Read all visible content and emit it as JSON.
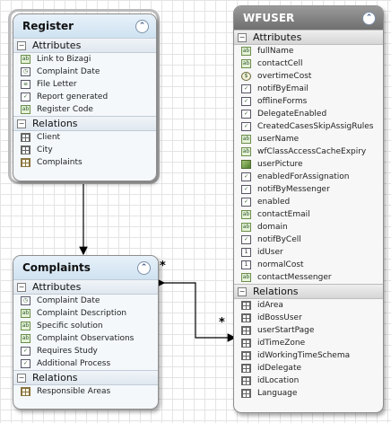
{
  "register": {
    "title": "Register",
    "collapse_glyph": "⌃",
    "attributes_label": "Attributes",
    "attributes": [
      {
        "label": "Link to Bizagi",
        "icon": "abc"
      },
      {
        "label": "Complaint Date",
        "icon": "date"
      },
      {
        "label": "File Letter",
        "icon": "file"
      },
      {
        "label": "Report generated",
        "icon": "bool"
      },
      {
        "label": "Register Code",
        "icon": "abc"
      }
    ],
    "relations_label": "Relations",
    "relations": [
      {
        "label": "Client",
        "icon": "rel"
      },
      {
        "label": "City",
        "icon": "rel"
      },
      {
        "label": "Complaints",
        "icon": "rel-multi"
      }
    ]
  },
  "complaints": {
    "title": "Complaints",
    "collapse_glyph": "⌃",
    "attributes_label": "Attributes",
    "attributes": [
      {
        "label": "Complaint Date",
        "icon": "date"
      },
      {
        "label": "Complaint Description",
        "icon": "abc"
      },
      {
        "label": "Specific solution",
        "icon": "abc"
      },
      {
        "label": "Complaint Observations",
        "icon": "abc"
      },
      {
        "label": "Requires Study",
        "icon": "bool"
      },
      {
        "label": "Additional Process",
        "icon": "bool"
      }
    ],
    "relations_label": "Relations",
    "relations": [
      {
        "label": "Responsible Areas",
        "icon": "rel-multi"
      }
    ]
  },
  "wfuser": {
    "title": "WFUSER",
    "collapse_glyph": "⌃",
    "attributes_label": "Attributes",
    "attributes": [
      {
        "label": "fullName",
        "icon": "abc"
      },
      {
        "label": "contactCell",
        "icon": "abc"
      },
      {
        "label": "overtimeCost",
        "icon": "cur"
      },
      {
        "label": "notifByEmail",
        "icon": "bool"
      },
      {
        "label": "offlineForms",
        "icon": "bool"
      },
      {
        "label": "DelegateEnabled",
        "icon": "bool"
      },
      {
        "label": "CreatedCasesSkipAssigRules",
        "icon": "bool"
      },
      {
        "label": "userName",
        "icon": "abc"
      },
      {
        "label": "wfClassAccessCacheExpiry",
        "icon": "abc"
      },
      {
        "label": "userPicture",
        "icon": "img"
      },
      {
        "label": "enabledForAssignation",
        "icon": "bool"
      },
      {
        "label": "notifByMessenger",
        "icon": "bool"
      },
      {
        "label": "enabled",
        "icon": "bool"
      },
      {
        "label": "contactEmail",
        "icon": "abc"
      },
      {
        "label": "domain",
        "icon": "abc"
      },
      {
        "label": "notifByCell",
        "icon": "bool"
      },
      {
        "label": "idUser",
        "icon": "num"
      },
      {
        "label": "normalCost",
        "icon": "num"
      },
      {
        "label": "contactMessenger",
        "icon": "abc"
      }
    ],
    "relations_label": "Relations",
    "relations": [
      {
        "label": "idArea",
        "icon": "rel"
      },
      {
        "label": "idBossUser",
        "icon": "rel"
      },
      {
        "label": "userStartPage",
        "icon": "rel"
      },
      {
        "label": "idTimeZone",
        "icon": "rel"
      },
      {
        "label": "idWorkingTimeSchema",
        "icon": "rel"
      },
      {
        "label": "idDelegate",
        "icon": "rel"
      },
      {
        "label": "idLocation",
        "icon": "rel"
      },
      {
        "label": "Language",
        "icon": "rel"
      }
    ]
  },
  "multiplicities": {
    "complaints_end": "*",
    "wfuser_end": "*"
  },
  "icon_glyphs": {
    "abc": "ab",
    "date": "◷",
    "file": "≡",
    "bool": "✓",
    "num": "1",
    "cur": "$",
    "img": "",
    "rel": "",
    "rel-multi": ""
  }
}
